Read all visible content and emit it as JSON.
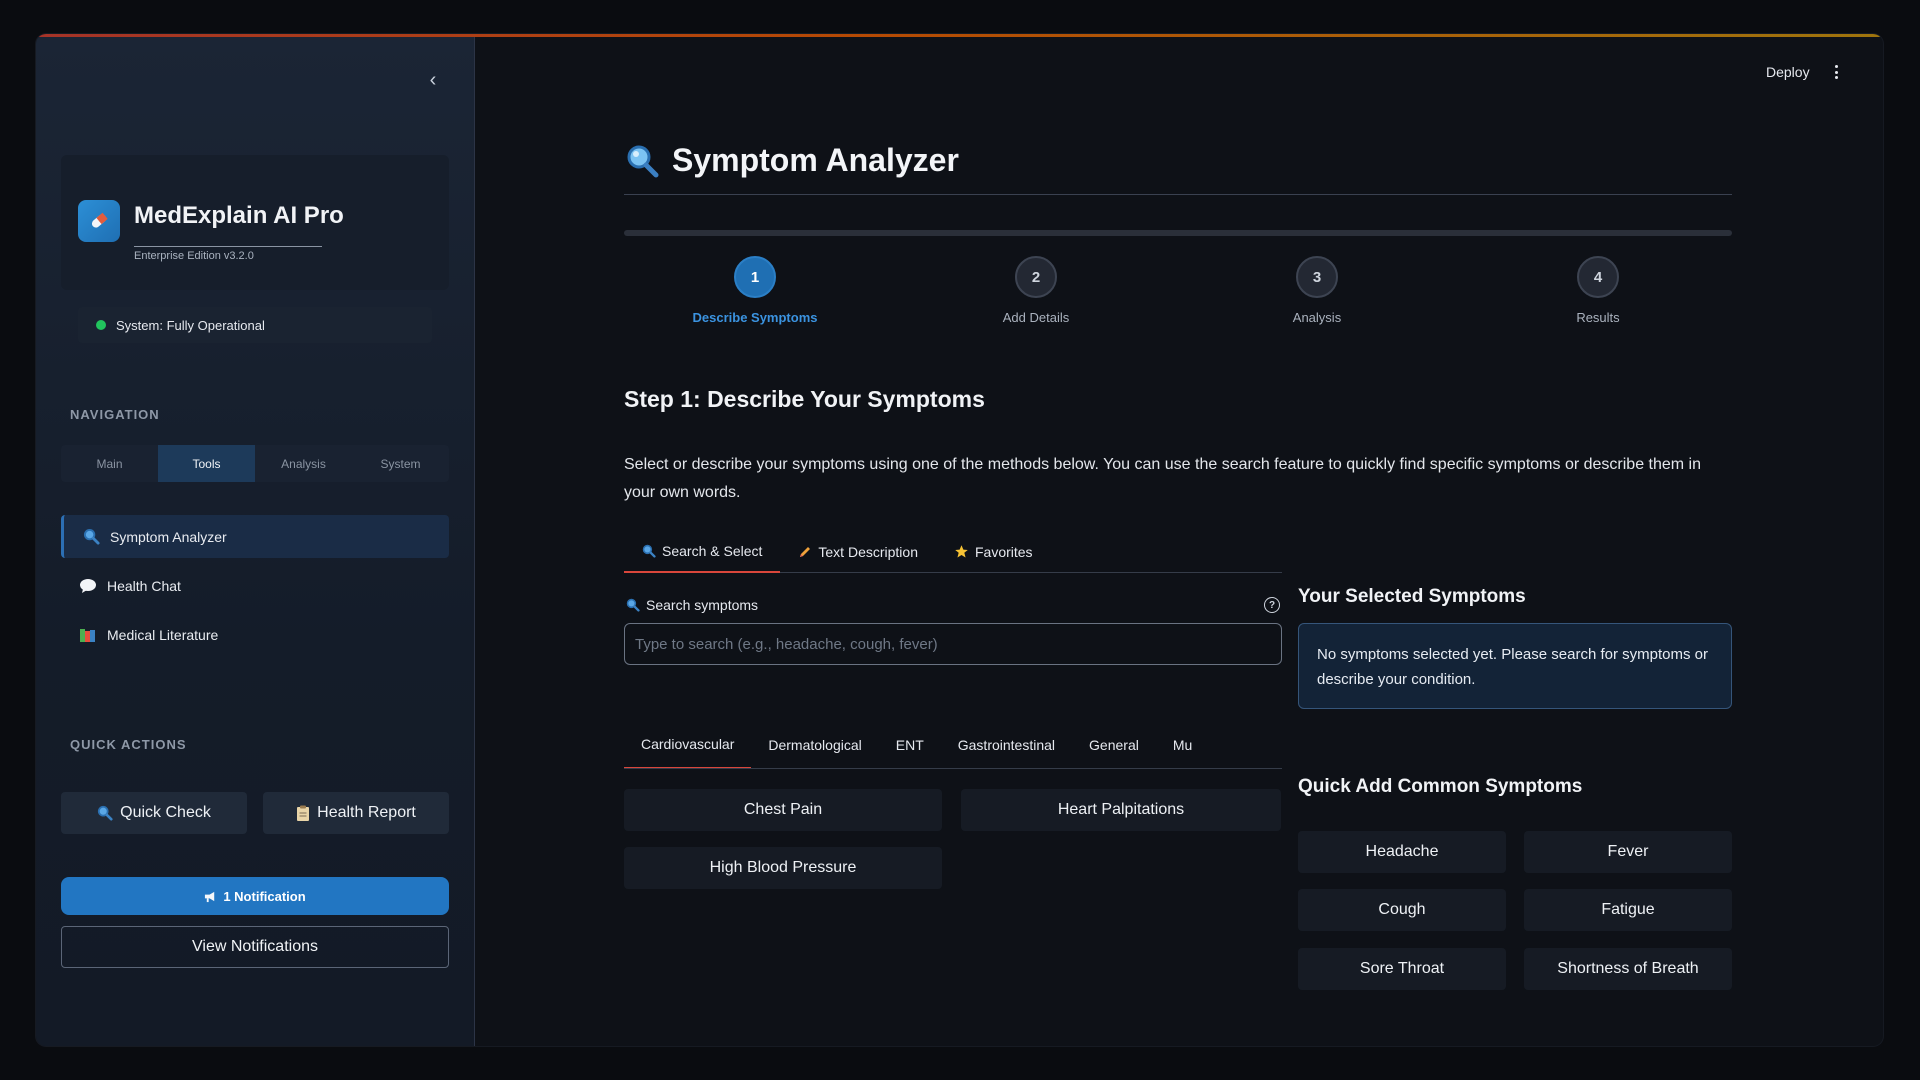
{
  "sidebar": {
    "collapse_glyph": "‹",
    "brand": {
      "title": "MedExplain AI Pro",
      "subtitle": "Enterprise Edition v3.2.0",
      "logo_icon": "pill-icon"
    },
    "status": "System: Fully Operational",
    "status_color": "#21c45d",
    "navigation_label": "NAVIGATION",
    "nav_tabs": [
      "Main",
      "Tools",
      "Analysis",
      "System"
    ],
    "nav_tabs_active": "Tools",
    "nav_items": [
      {
        "label": "Symptom Analyzer",
        "icon": "magnifier-icon",
        "active": true
      },
      {
        "label": "Health Chat",
        "icon": "speech-bubble-icon",
        "active": false
      },
      {
        "label": "Medical Literature",
        "icon": "books-icon",
        "active": false
      }
    ],
    "quick_actions_label": "QUICK ACTIONS",
    "quick_check": "Quick Check",
    "health_report": "Health Report",
    "notification": "1 Notification",
    "view_notifications": "View Notifications"
  },
  "header": {
    "deploy": "Deploy"
  },
  "main": {
    "title": "Symptom Analyzer",
    "steps": [
      {
        "num": "1",
        "label": "Describe Symptoms",
        "active": true
      },
      {
        "num": "2",
        "label": "Add Details",
        "active": false
      },
      {
        "num": "3",
        "label": "Analysis",
        "active": false
      },
      {
        "num": "4",
        "label": "Results",
        "active": false
      }
    ],
    "step_heading": "Step 1: Describe Your Symptoms",
    "description": "Select or describe your symptoms using one of the methods below. You can use the search feature to quickly find specific symptoms or describe them in your own words.",
    "tabs": [
      "Search & Select",
      "Text Description",
      "Favorites"
    ],
    "search_label": "Search symptoms",
    "search_placeholder": "Type to search (e.g., headache, cough, fever)",
    "search_value": "",
    "categories": [
      "Cardiovascular",
      "Dermatological",
      "ENT",
      "Gastrointestinal",
      "General",
      "Mu"
    ],
    "category_symptoms": [
      "Chest Pain",
      "Heart Palpitations",
      "High Blood Pressure"
    ],
    "selected_heading": "Your Selected Symptoms",
    "selected_empty": "No symptoms selected yet. Please search for symptoms or describe your condition.",
    "quick_add_heading": "Quick Add Common Symptoms",
    "quick_add": [
      "Headache",
      "Fever",
      "Cough",
      "Fatigue",
      "Sore Throat",
      "Shortness of Breath"
    ]
  },
  "colors": {
    "accent": "#1f6fb3",
    "tab_underline": "#d9463b",
    "background": "#0e1117",
    "sidebar": "#1b2535"
  }
}
